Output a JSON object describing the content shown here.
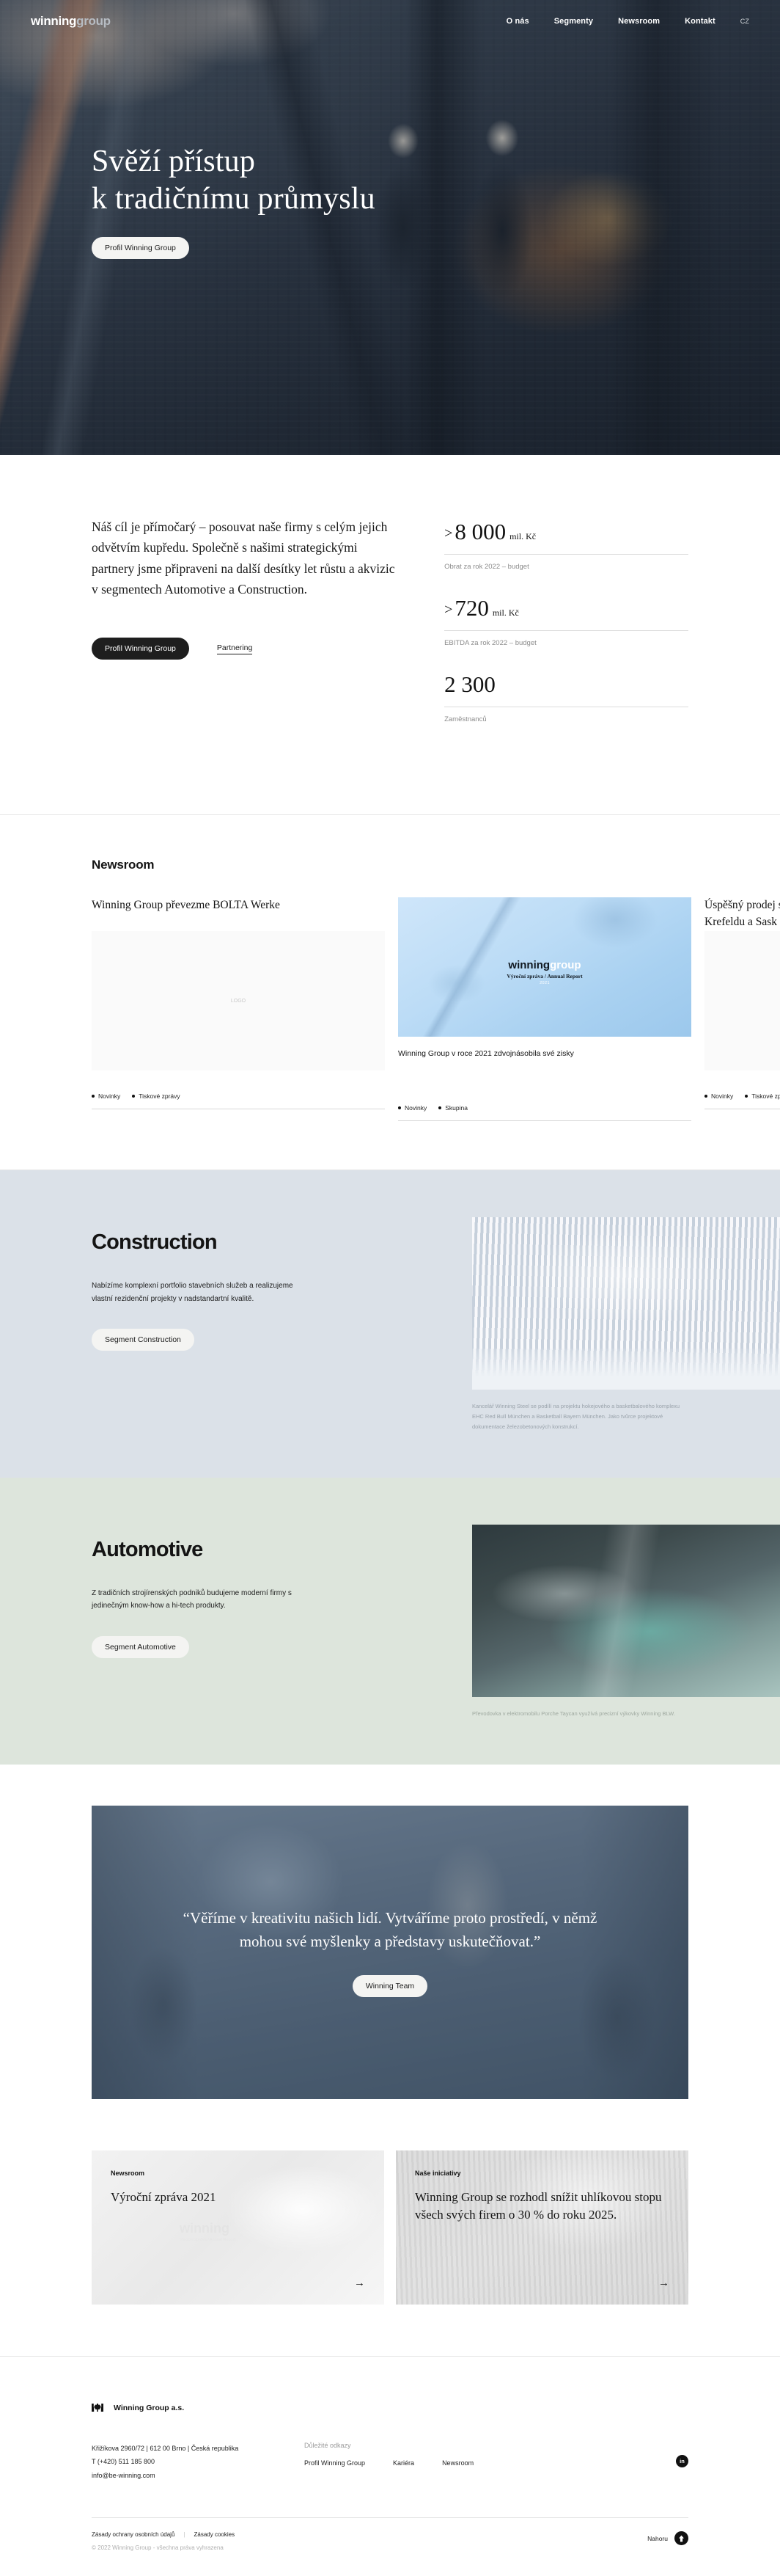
{
  "header": {
    "logo_word1": "winning",
    "logo_word2": "group",
    "nav": [
      {
        "label": "O nás"
      },
      {
        "label": "Segmenty"
      },
      {
        "label": "Newsroom"
      },
      {
        "label": "Kontakt"
      }
    ],
    "lang": "CZ"
  },
  "hero": {
    "line1": "Svěží přístup",
    "line2": "k tradičnímu průmyslu",
    "cta": "Profil Winning Group"
  },
  "intro": {
    "copy": "Náš cíl je přímočarý – posouvat naše firmy s celým jejich odvětvím kupředu. Společně s našimi strategickými partnery jsme připraveni na další desítky let růstu a akvizic v segmentech Automotive a Construction.",
    "cta_primary": "Profil Winning Group",
    "cta_secondary": "Partnering",
    "stats": [
      {
        "value": "8 000",
        "prefix": ">",
        "unit": "mil. Kč",
        "label": "Obrat za rok 2022 – budget"
      },
      {
        "value": "720",
        "prefix": ">",
        "unit": "mil. Kč",
        "label": "EBITDA za rok 2022 – budget"
      },
      {
        "value": "2 300",
        "prefix": "",
        "unit": "",
        "label": "Zaměstnanců"
      }
    ]
  },
  "newsroom": {
    "heading": "Newsroom",
    "cards": [
      {
        "title": "Winning Group převezme BOLTA Werke",
        "thumb_kind": "placeholder",
        "thumb_placeholder": "LOGO",
        "tags": [
          "Novinky",
          "Tiskové zprávy"
        ]
      },
      {
        "title": "Winning Group v roce 2021 zdvojnásobila své zisky",
        "thumb_kind": "annual-report",
        "cover_word1": "winning",
        "cover_word2": "group",
        "cover_subtitle": "Výroční zpráva / Annual Report",
        "cover_year": "2021",
        "tags": [
          "Novinky",
          "Skupina"
        ]
      },
      {
        "title": "Úspěšný prodej s",
        "title_full": "Úspěšný prodej s Winning Group p pro automobilový z Krefeldu a Sask",
        "thumb_kind": "placeholder",
        "thumb_placeholder": "",
        "tags": [
          "Novinky",
          "Tiskové zprávy"
        ]
      }
    ]
  },
  "segments": [
    {
      "id": "construction",
      "heading": "Construction",
      "copy": "Nabízíme komplexní portfolio stavebních služeb a realizujeme vlastní rezidenční projekty v nadstandartní kvalitě.",
      "cta": "Segment Construction",
      "caption": "Kancelář Winning Steel se podílí na projektu hokejového a basketbalového komplexu EHC Red Bull München a Basketball Bayern München. Jako tvůrce projektové dokumentace železobetonových konstrukcí."
    },
    {
      "id": "automotive",
      "heading": "Automotive",
      "copy": "Z tradičních strojírenských podniků budujeme moderní firmy s jedinečným know-how a hi-tech produkty.",
      "cta": "Segment Automotive",
      "caption": "Převodovka v elektromobilu Porche Taycan využívá precizní výkovky Winning BLW."
    }
  ],
  "quote": {
    "text": "“Věříme v kreativitu našich lidí. Vytváříme proto prostředí, v němž mohou své myšlenky a představy uskutečňovat.”",
    "cta": "Winning Team"
  },
  "cards": [
    {
      "eyebrow": "Newsroom",
      "title": "Výroční zpráva 2021",
      "arrow": "→",
      "watermark_main": "winning",
      "watermark_sub": "Výroční zpráva / Annual Report"
    },
    {
      "eyebrow": "Naše iniciativy",
      "title": "Winning Group se rozhodl snížit uhlíkovou stopu všech svých firem o 30 % do roku 2025.",
      "arrow": "→"
    }
  ],
  "footer": {
    "brand_name": "Winning Group a.s.",
    "address_line1": "Křižíkova 2960/72 | 612 00 Brno | Česká republika",
    "address_line2": "T (+420) 511 185 800",
    "address_line3": "info@be-winning.com",
    "links_heading": "Důležité odkazy",
    "links": [
      {
        "label": "Profil Winning Group"
      },
      {
        "label": "Kariéra"
      },
      {
        "label": "Newsroom"
      }
    ],
    "social_label": "in",
    "legal": [
      {
        "label": "Zásady ochrany osobních údajů"
      },
      {
        "label": "Zásady cookies"
      }
    ],
    "separator": "|",
    "copyright": "© 2022 Winning Group - všechna práva vyhrazena",
    "back_to_top": "Nahoru",
    "back_to_top_arrow": "↑"
  }
}
